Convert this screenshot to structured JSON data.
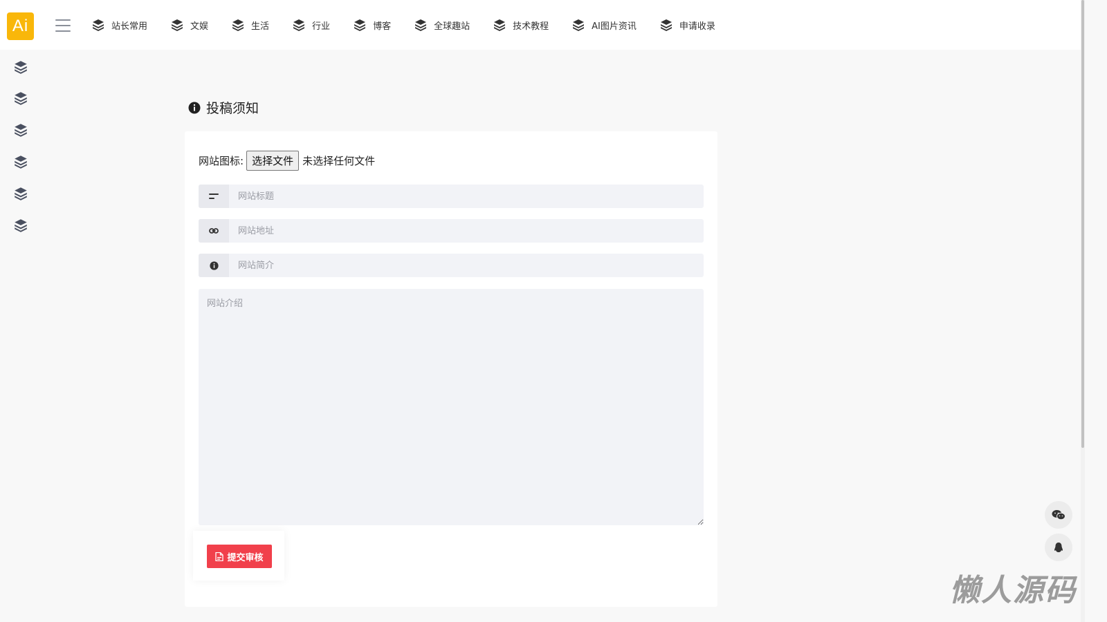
{
  "header": {
    "logo_text": "Ai",
    "nav": [
      {
        "label": "站长常用",
        "icon": "layers-icon"
      },
      {
        "label": "文娱",
        "icon": "layers-icon"
      },
      {
        "label": "生活",
        "icon": "layers-icon"
      },
      {
        "label": "行业",
        "icon": "layers-icon"
      },
      {
        "label": "博客",
        "icon": "layers-icon"
      },
      {
        "label": "全球趣站",
        "icon": "layers-icon"
      },
      {
        "label": "技术教程",
        "icon": "layers-icon"
      },
      {
        "label": "AI图片资讯",
        "icon": "layers-icon"
      },
      {
        "label": "申请收录",
        "icon": "layers-icon"
      }
    ]
  },
  "sidebar": {
    "items": [
      "layers-icon",
      "layers-icon",
      "layers-icon",
      "layers-icon",
      "layers-icon",
      "layers-icon"
    ]
  },
  "main": {
    "section_title": "投稿须知",
    "file_label": "网站图标:",
    "file_button": "选择文件",
    "file_status": "未选择任何文件",
    "title_placeholder": "网站标题",
    "url_placeholder": "网站地址",
    "summary_placeholder": "网站简介",
    "intro_placeholder": "网站介绍",
    "submit_label": "提交审核"
  },
  "floating": [
    "wechat-icon",
    "qq-icon"
  ],
  "watermark": "懒人源码",
  "colors": {
    "logo": "#f9b70a",
    "submit": "#f1404b",
    "input_bg": "#f2f3f7"
  }
}
